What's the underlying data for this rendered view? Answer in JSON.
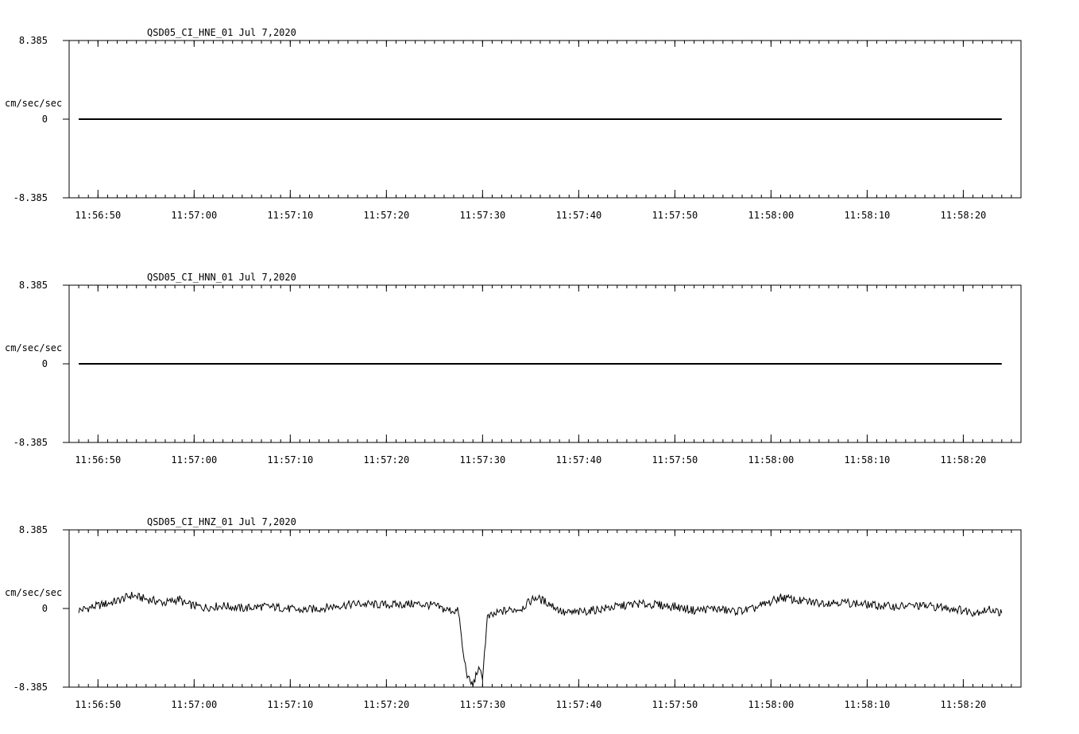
{
  "chart_data": [
    {
      "type": "line",
      "title": "QSD05_CI_HNE_01  Jul 7,2020",
      "ylabel": "cm/sec/sec",
      "ylim": [
        -8.385,
        8.385
      ],
      "yticks": [
        "8.385",
        "0",
        "-8.385"
      ],
      "xlim": [
        "11:56:47",
        "11:58:26"
      ],
      "xticks": [
        "11:56:50",
        "11:57:00",
        "11:57:10",
        "11:57:20",
        "11:57:30",
        "11:57:40",
        "11:57:50",
        "11:58:00",
        "11:58:10",
        "11:58:20"
      ],
      "series": [
        {
          "x": [
            "11:56:48",
            "11:57:00",
            "11:57:10",
            "11:57:20",
            "11:57:30",
            "11:57:40",
            "11:57:50",
            "11:58:00",
            "11:58:10",
            "11:58:24"
          ],
          "values": [
            0,
            0,
            0,
            0,
            0,
            0,
            0,
            0,
            0,
            0
          ]
        }
      ]
    },
    {
      "type": "line",
      "title": "QSD05_CI_HNN_01  Jul 7,2020",
      "ylabel": "cm/sec/sec",
      "ylim": [
        -8.385,
        8.385
      ],
      "yticks": [
        "8.385",
        "0",
        "-8.385"
      ],
      "xlim": [
        "11:56:47",
        "11:58:26"
      ],
      "xticks": [
        "11:56:50",
        "11:57:00",
        "11:57:10",
        "11:57:20",
        "11:57:30",
        "11:57:40",
        "11:57:50",
        "11:58:00",
        "11:58:10",
        "11:58:20"
      ],
      "series": [
        {
          "x": [
            "11:56:48",
            "11:57:00",
            "11:57:10",
            "11:57:20",
            "11:57:30",
            "11:57:40",
            "11:57:50",
            "11:58:00",
            "11:58:10",
            "11:58:24"
          ],
          "values": [
            0,
            0,
            0,
            0,
            0,
            0,
            0,
            0,
            0,
            0
          ]
        }
      ]
    },
    {
      "type": "line",
      "title": "QSD05_CI_HNZ_01  Jul 7,2020",
      "ylabel": "cm/sec/sec",
      "ylim": [
        -8.385,
        8.385
      ],
      "yticks": [
        "8.385",
        "0",
        "-8.385"
      ],
      "xlim": [
        "11:56:47",
        "11:58:26"
      ],
      "xticks": [
        "11:56:50",
        "11:57:00",
        "11:57:10",
        "11:57:20",
        "11:57:30",
        "11:57:40",
        "11:57:50",
        "11:58:00",
        "11:58:10",
        "11:58:20"
      ],
      "series": [
        {
          "x": [
            "11:56:48",
            "11:56:50",
            "11:56:52",
            "11:56:53.5",
            "11:56:55",
            "11:56:57",
            "11:56:58.5",
            "11:56:59",
            "11:57:01",
            "11:57:03",
            "11:57:05",
            "11:57:07",
            "11:57:09",
            "11:57:11",
            "11:57:13",
            "11:57:15",
            "11:57:17",
            "11:57:19",
            "11:57:21",
            "11:57:23",
            "11:57:25",
            "11:57:26",
            "11:57:27.5",
            "11:57:28",
            "11:57:28.5",
            "11:57:29",
            "11:57:29.5",
            "11:57:30",
            "11:57:30.5",
            "11:57:32",
            "11:57:34",
            "11:57:35.5",
            "11:57:37",
            "11:57:38.5",
            "11:57:40",
            "11:57:42",
            "11:57:44",
            "11:57:46",
            "11:57:48",
            "11:57:50",
            "11:57:52",
            "11:57:54",
            "11:57:56",
            "11:57:58",
            "11:58:00",
            "11:58:01",
            "11:58:03",
            "11:58:05",
            "11:58:07",
            "11:58:09",
            "11:58:11",
            "11:58:13",
            "11:58:15",
            "11:58:17",
            "11:58:19",
            "11:58:21",
            "11:58:23",
            "11:58:24"
          ],
          "values": [
            -0.2,
            0.3,
            0.8,
            1.4,
            1.0,
            0.6,
            1.0,
            0.5,
            0.1,
            0.3,
            0.0,
            0.2,
            0.1,
            -0.2,
            0.0,
            0.3,
            0.5,
            0.4,
            0.4,
            0.5,
            0.3,
            -0.1,
            -0.3,
            -5.0,
            -7.5,
            -8.2,
            -6.5,
            -7.2,
            -1.0,
            -0.3,
            0.0,
            1.2,
            0.5,
            -0.5,
            -0.4,
            -0.1,
            0.2,
            0.5,
            0.4,
            0.2,
            -0.2,
            0.0,
            -0.3,
            -0.1,
            0.7,
            1.2,
            0.8,
            0.6,
            0.7,
            0.5,
            0.3,
            0.2,
            0.3,
            0.2,
            0.0,
            -0.4,
            -0.1,
            -0.5
          ]
        }
      ]
    }
  ]
}
